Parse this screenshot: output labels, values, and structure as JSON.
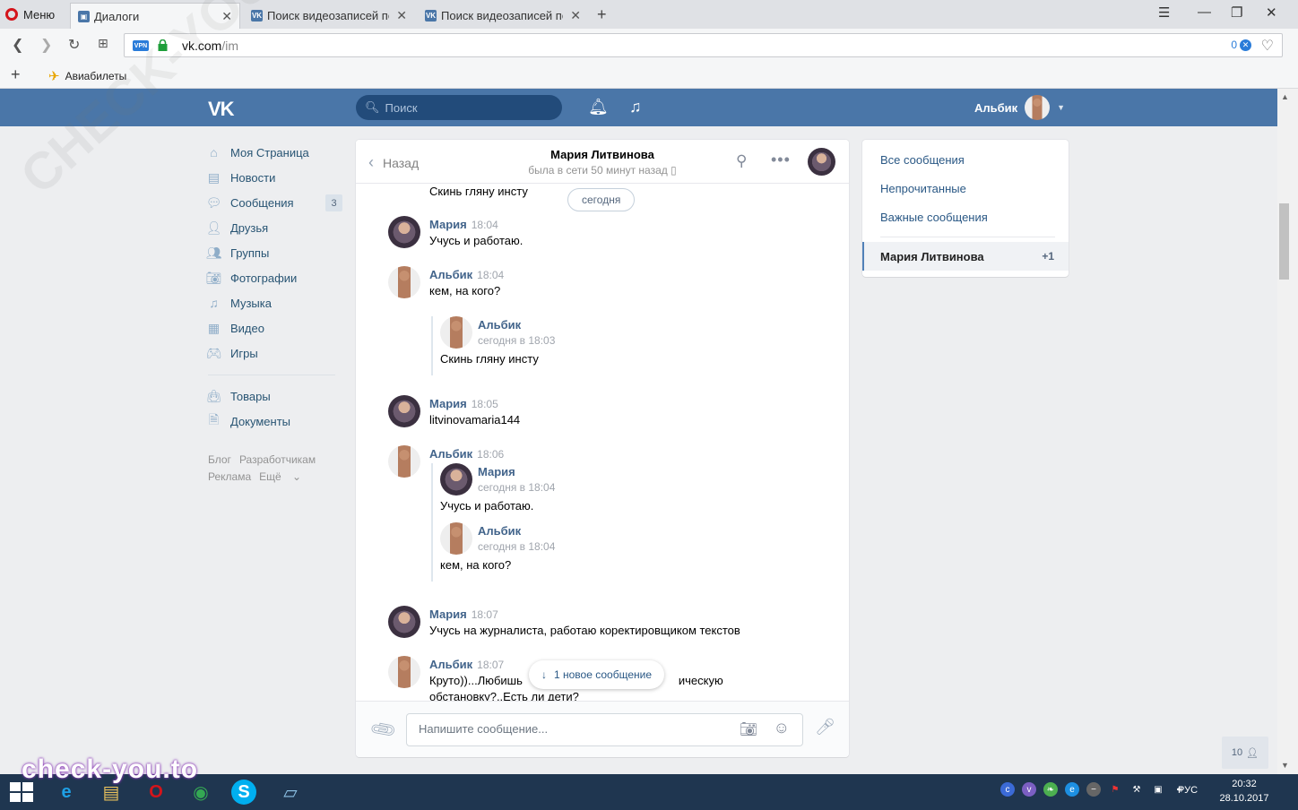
{
  "browser": {
    "menu_label": "Меню",
    "tabs": [
      {
        "label": "Диалоги",
        "active": true
      },
      {
        "label": "Поиск видеозаписей по з",
        "active": false
      },
      {
        "label": "Поиск видеозаписей по з",
        "active": false
      }
    ],
    "url_host": "vk.com",
    "url_path": "/im",
    "vpn_label": "VPN",
    "blocked_count": "0",
    "bookmark": "Авиабилеты"
  },
  "vk_header": {
    "search_placeholder": "Поиск",
    "user_name": "Альбик"
  },
  "left_menu": {
    "items": [
      {
        "label": "Моя Страница",
        "icon": "home-icon"
      },
      {
        "label": "Новости",
        "icon": "news-icon"
      },
      {
        "label": "Сообщения",
        "icon": "messages-icon",
        "count": "3"
      },
      {
        "label": "Друзья",
        "icon": "friends-icon"
      },
      {
        "label": "Группы",
        "icon": "groups-icon"
      },
      {
        "label": "Фотографии",
        "icon": "camera-icon"
      },
      {
        "label": "Музыка",
        "icon": "music-icon"
      },
      {
        "label": "Видео",
        "icon": "video-icon"
      },
      {
        "label": "Игры",
        "icon": "gamepad-icon"
      }
    ],
    "secondary": [
      {
        "label": "Товары",
        "icon": "bag-icon"
      },
      {
        "label": "Документы",
        "icon": "document-icon"
      }
    ],
    "footer": [
      "Блог",
      "Разработчикам",
      "Реклама",
      "Ещё"
    ]
  },
  "chat": {
    "back_label": "Назад",
    "title": "Мария Литвинова",
    "status": "была в сети 50 минут назад",
    "day_label": "сегодня",
    "top_fragment": "Скинь гляну инсту",
    "messages": [
      {
        "author": "Мария",
        "time": "18:04",
        "text": "Учусь и работаю."
      },
      {
        "author": "Альбик",
        "time": "18:04",
        "text": "кем, на кого?",
        "forward": [
          {
            "author": "Альбик",
            "time": "сегодня в 18:03",
            "text": "Скинь гляну инсту"
          }
        ]
      },
      {
        "author": "Мария",
        "time": "18:05",
        "text": "litvinovamaria144"
      },
      {
        "author": "Альбик",
        "time": "18:06",
        "forward": [
          {
            "author": "Мария",
            "time": "сегодня в 18:04",
            "text": "Учусь и работаю."
          },
          {
            "author": "Альбик",
            "time": "сегодня в 18:04",
            "text": "кем, на кого?"
          }
        ]
      },
      {
        "author": "Мария",
        "time": "18:07",
        "text": "Учусь на журналиста, работаю коректировщиком текстов"
      },
      {
        "author": "Альбик",
        "time": "18:07",
        "text_line1_a": "Круто))...Любишь",
        "text_line1_b": "ическую",
        "text_line2": "обстановку?..Есть ли дети?"
      }
    ],
    "new_message_label": "1 новое сообщение",
    "composer_placeholder": "Напишите сообщение..."
  },
  "right_panel": {
    "items": [
      "Все сообщения",
      "Непрочитанные",
      "Важные сообщения"
    ],
    "active_dialog": "Мария Литвинова",
    "active_count": "+1"
  },
  "online_count": "10",
  "taskbar": {
    "lang": "РУС",
    "time": "20:32",
    "date": "28.10.2017"
  },
  "watermark": "check-you.to",
  "watermark_diag": "CHECK-YOU.ME"
}
